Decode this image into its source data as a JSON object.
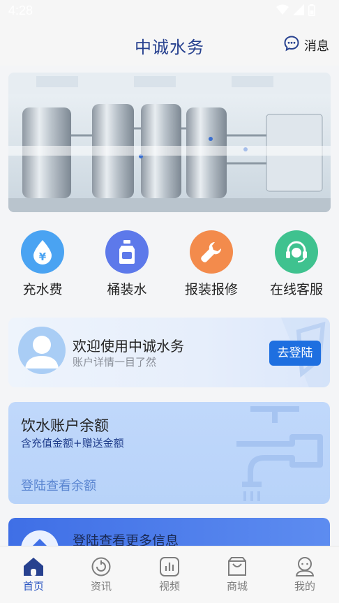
{
  "status_bar": {
    "time": "4:28"
  },
  "header": {
    "title": "中诚水务",
    "message_label": "消息"
  },
  "quick_actions": [
    {
      "label": "充水费",
      "icon": "yen-drop-icon",
      "color": "#4aa3f2"
    },
    {
      "label": "桶装水",
      "icon": "water-bucket-icon",
      "color": "#5d79ea"
    },
    {
      "label": "报装报修",
      "icon": "wrench-icon",
      "color": "#f38b4c"
    },
    {
      "label": "在线客服",
      "icon": "headset-icon",
      "color": "#3fc28f"
    }
  ],
  "welcome": {
    "title": "欢迎使用中诚水务",
    "subtitle": "账户详情一目了然",
    "login_button": "去登陆"
  },
  "balance": {
    "title": "饮水账户余额",
    "subtitle": "含充值金额+赠送金额",
    "link": "登陆查看余额"
  },
  "more_info": {
    "title": "登陆查看更多信息"
  },
  "tabbar": {
    "items": [
      {
        "label": "首页",
        "icon": "home-icon"
      },
      {
        "label": "资讯",
        "icon": "news-icon"
      },
      {
        "label": "视频",
        "icon": "video-icon"
      },
      {
        "label": "商城",
        "icon": "shop-bag-icon"
      },
      {
        "label": "我的",
        "icon": "profile-icon"
      }
    ],
    "active": "首页"
  },
  "colors": {
    "brand_blue": "#27418f",
    "accent": "#1e6fe0",
    "active_tab": "#2b56c2"
  }
}
